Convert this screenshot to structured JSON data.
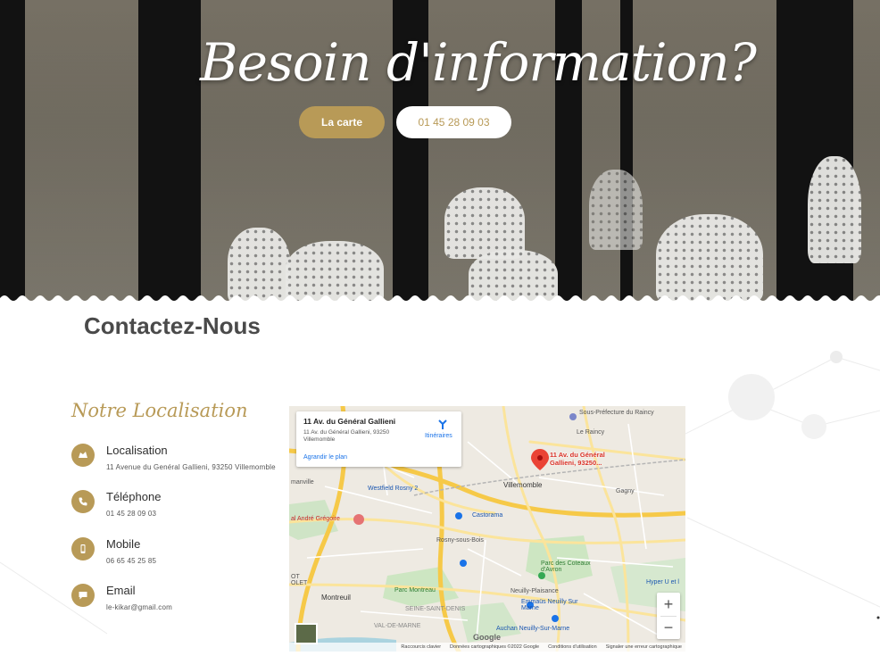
{
  "hero": {
    "title": "Besoin d'information?",
    "btn_carte": "La carte",
    "btn_phone": "01 45 28 09 03"
  },
  "contact": {
    "title": "Contactez-Nous",
    "location_heading": "Notre Localisation",
    "items": [
      {
        "label": "Localisation",
        "value": "11 Avenue du Genéral Gallieni, 93250 Villemomble",
        "icon": "location-icon"
      },
      {
        "label": "Téléphone",
        "value": "01 45 28 09 03",
        "icon": "phone-icon"
      },
      {
        "label": "Mobile",
        "value": "06 65 45 25 85",
        "icon": "mobile-icon"
      },
      {
        "label": "Email",
        "value": "le-kikar@gmail.com",
        "icon": "email-icon"
      }
    ]
  },
  "map": {
    "card_title": "11 Av. du Général Gallieni",
    "card_address": "11 Av. du Général Gallieni, 93250 Villemomble",
    "card_enlarge": "Agrandir le plan",
    "card_directions": "Itinéraires",
    "pin_label": "11 Av. du Général Gallieni, 93250...",
    "zoom_in": "+",
    "zoom_out": "−",
    "google": "Google",
    "footer": [
      "Raccourcis clavier",
      "Données cartographiques ©2022 Google",
      "Conditions d'utilisation",
      "Signaler une erreur cartographique"
    ],
    "places": {
      "sous_prefecture": "Sous-Préfecture du Raincy",
      "le_raincy": "Le Raincy",
      "villemomble": "Villemomble",
      "gagny": "Gagny",
      "westfield": "Westfield Rosny 2",
      "castorama": "Castorama",
      "rosny": "Rosny-sous-Bois",
      "andre_gregoire": "al André Grégoire",
      "parc_coteaux": "Parc des Coteaux d'Avron",
      "neuilly_plaisance": "Neuilly-Plaisance",
      "montreuil": "Montreuil",
      "parc_montreau": "Parc Montreau",
      "emmaus": "Emmaüs Neuilly Sur Marne",
      "auchan": "Auchan Neuilly-Sur-Marne",
      "hyper": "Hyper U et l",
      "seine_st_denis": "SEINE-SAINT-DENIS",
      "val_de_marne": "VAL-DE-MARNE",
      "manville": "manville",
      "olet": "OT OLET"
    }
  }
}
